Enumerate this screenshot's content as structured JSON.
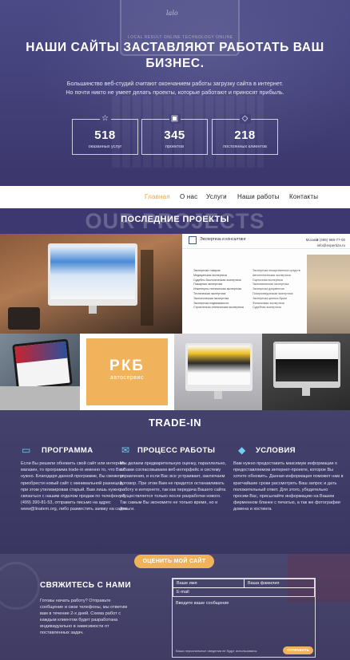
{
  "hero": {
    "logo": "lalo",
    "tiny_text": "LOCAL RESULT ONLINE TECHNOLOGY ONLINE",
    "title": "НАШИ САЙТЫ ЗАСТАВЛЯЮТ РАБОТАТЬ ВАШ БИЗНЕС.",
    "text": "Большинство веб-студий считают окончанием работы загрузку сайта в интернет. Но почти никто не умеет делать проекты, которые работают и приносят прибыль.",
    "stats": [
      {
        "icon": "star-icon",
        "value": "518",
        "label": "оказанных услуг"
      },
      {
        "icon": "briefcase-icon",
        "value": "345",
        "label": "проектов"
      },
      {
        "icon": "diamond-icon",
        "value": "218",
        "label": "постоянных клиентов"
      }
    ]
  },
  "nav": {
    "items": [
      "Главная",
      "О нас",
      "Услуги",
      "Наши работы",
      "Контакты"
    ],
    "active": "Главная",
    "active_color": "#e9a84b"
  },
  "projects": {
    "ghost": "OUR PROJECTS",
    "title": "ПОСЛЕДНИЕ ПРОЕКТЫ",
    "site": {
      "heading": "Экспертиза и консалтинг",
      "city": "Москва",
      "phone": "8 (495) 988-77-00",
      "email": "info@expertiza.ru",
      "list_left": [
        "Экспертиза товаров",
        "Медицинская экспертиза",
        "Судебно-биологическая экспертиза",
        "Пожарная экспертиза",
        "Инженерно-техническая экспертиза",
        "Техническая экспертиза",
        "Экологическая экспертиза",
        "Экспертиза недвижимости",
        "Строительно-техническая экспертиза"
      ],
      "list_right": [
        "Экспертиза лекарственных средств",
        "Автотехническая экспертиза",
        "Оценочная экспертиза",
        "Экономическая экспертиза",
        "Экспертиза документов",
        "Почерковедческая экспертиза",
        "Экспертиза ценных бумаг",
        "Финансовая экспертиза",
        "Судебная экспертиза"
      ]
    },
    "rkb": {
      "title": "РКБ",
      "subtitle": "автосервис"
    }
  },
  "trade": {
    "title": "TRADE-IN",
    "columns": [
      {
        "icon": "laptop-icon",
        "title": "ПРОГРАММА",
        "text": "Если Вы решили обновить свой сайт или интернет-магазин, то программа trade-in именно то, что Вам нужно. Благодаря данной программе, Вы сможете приобрести новый сайт с минимальной разницей, при этом утилизировав старый. Вам лишь нужно связаться с нашим отделом продаж по телефону 8 (499) 390-81-53, отправить письмо на адрес www@linatem.org, либо разместить заявку на сайте."
      },
      {
        "icon": "chat-icon",
        "title": "ПРОЦЕСС РАБОТЫ",
        "text": "Мы делаем предварительную оценку, параллельно, с Вами согласовываем веб-интерфейс и систему управления, и если Вас все устраивает, заключаем договор. При этом Вам не придется останавливать работу в интернете, так как передача Вашего сайта осуществляется только после разработки нового. Так самым Вы экономите не только время, но и деньги."
      },
      {
        "icon": "diamond-icon",
        "title": "УСЛОВИЯ",
        "text": "Вам нужно предоставить максимум информации о предоставляемом интернет-проекте, которое Вы хотите обновить. Данная информация поможет нам в кратчайшие сроки рассмотреть Ваш запрос и дать положительный ответ. Для этого, убедительно просим Вас, присылайте информацию на Вашем фирменном бланке с печатью, а так же фотографии домена и хостинга."
      }
    ],
    "button": "ОЦЕНИТЬ МОЙ САЙТ"
  },
  "contact": {
    "title": "СВЯЖИТЕСЬ С НАМИ",
    "text": "Готовы начать работу? Отправьте сообщение и свои телефоны, мы ответим вам в течение 2-х дней. Схема работ с каждым клиентом будет разработана индивидуально в зависимости от поставленных задач.",
    "form": {
      "name_placeholder": "Ваше имя",
      "surname_placeholder": "Ваша фамилия",
      "email_placeholder": "E-mail",
      "message_placeholder": "Введите ваше сообщение",
      "note": "Ваши персональные сведения не будут использованы",
      "submit": "ОТПРАВИТЬ"
    },
    "accent": "#f0b35c"
  }
}
